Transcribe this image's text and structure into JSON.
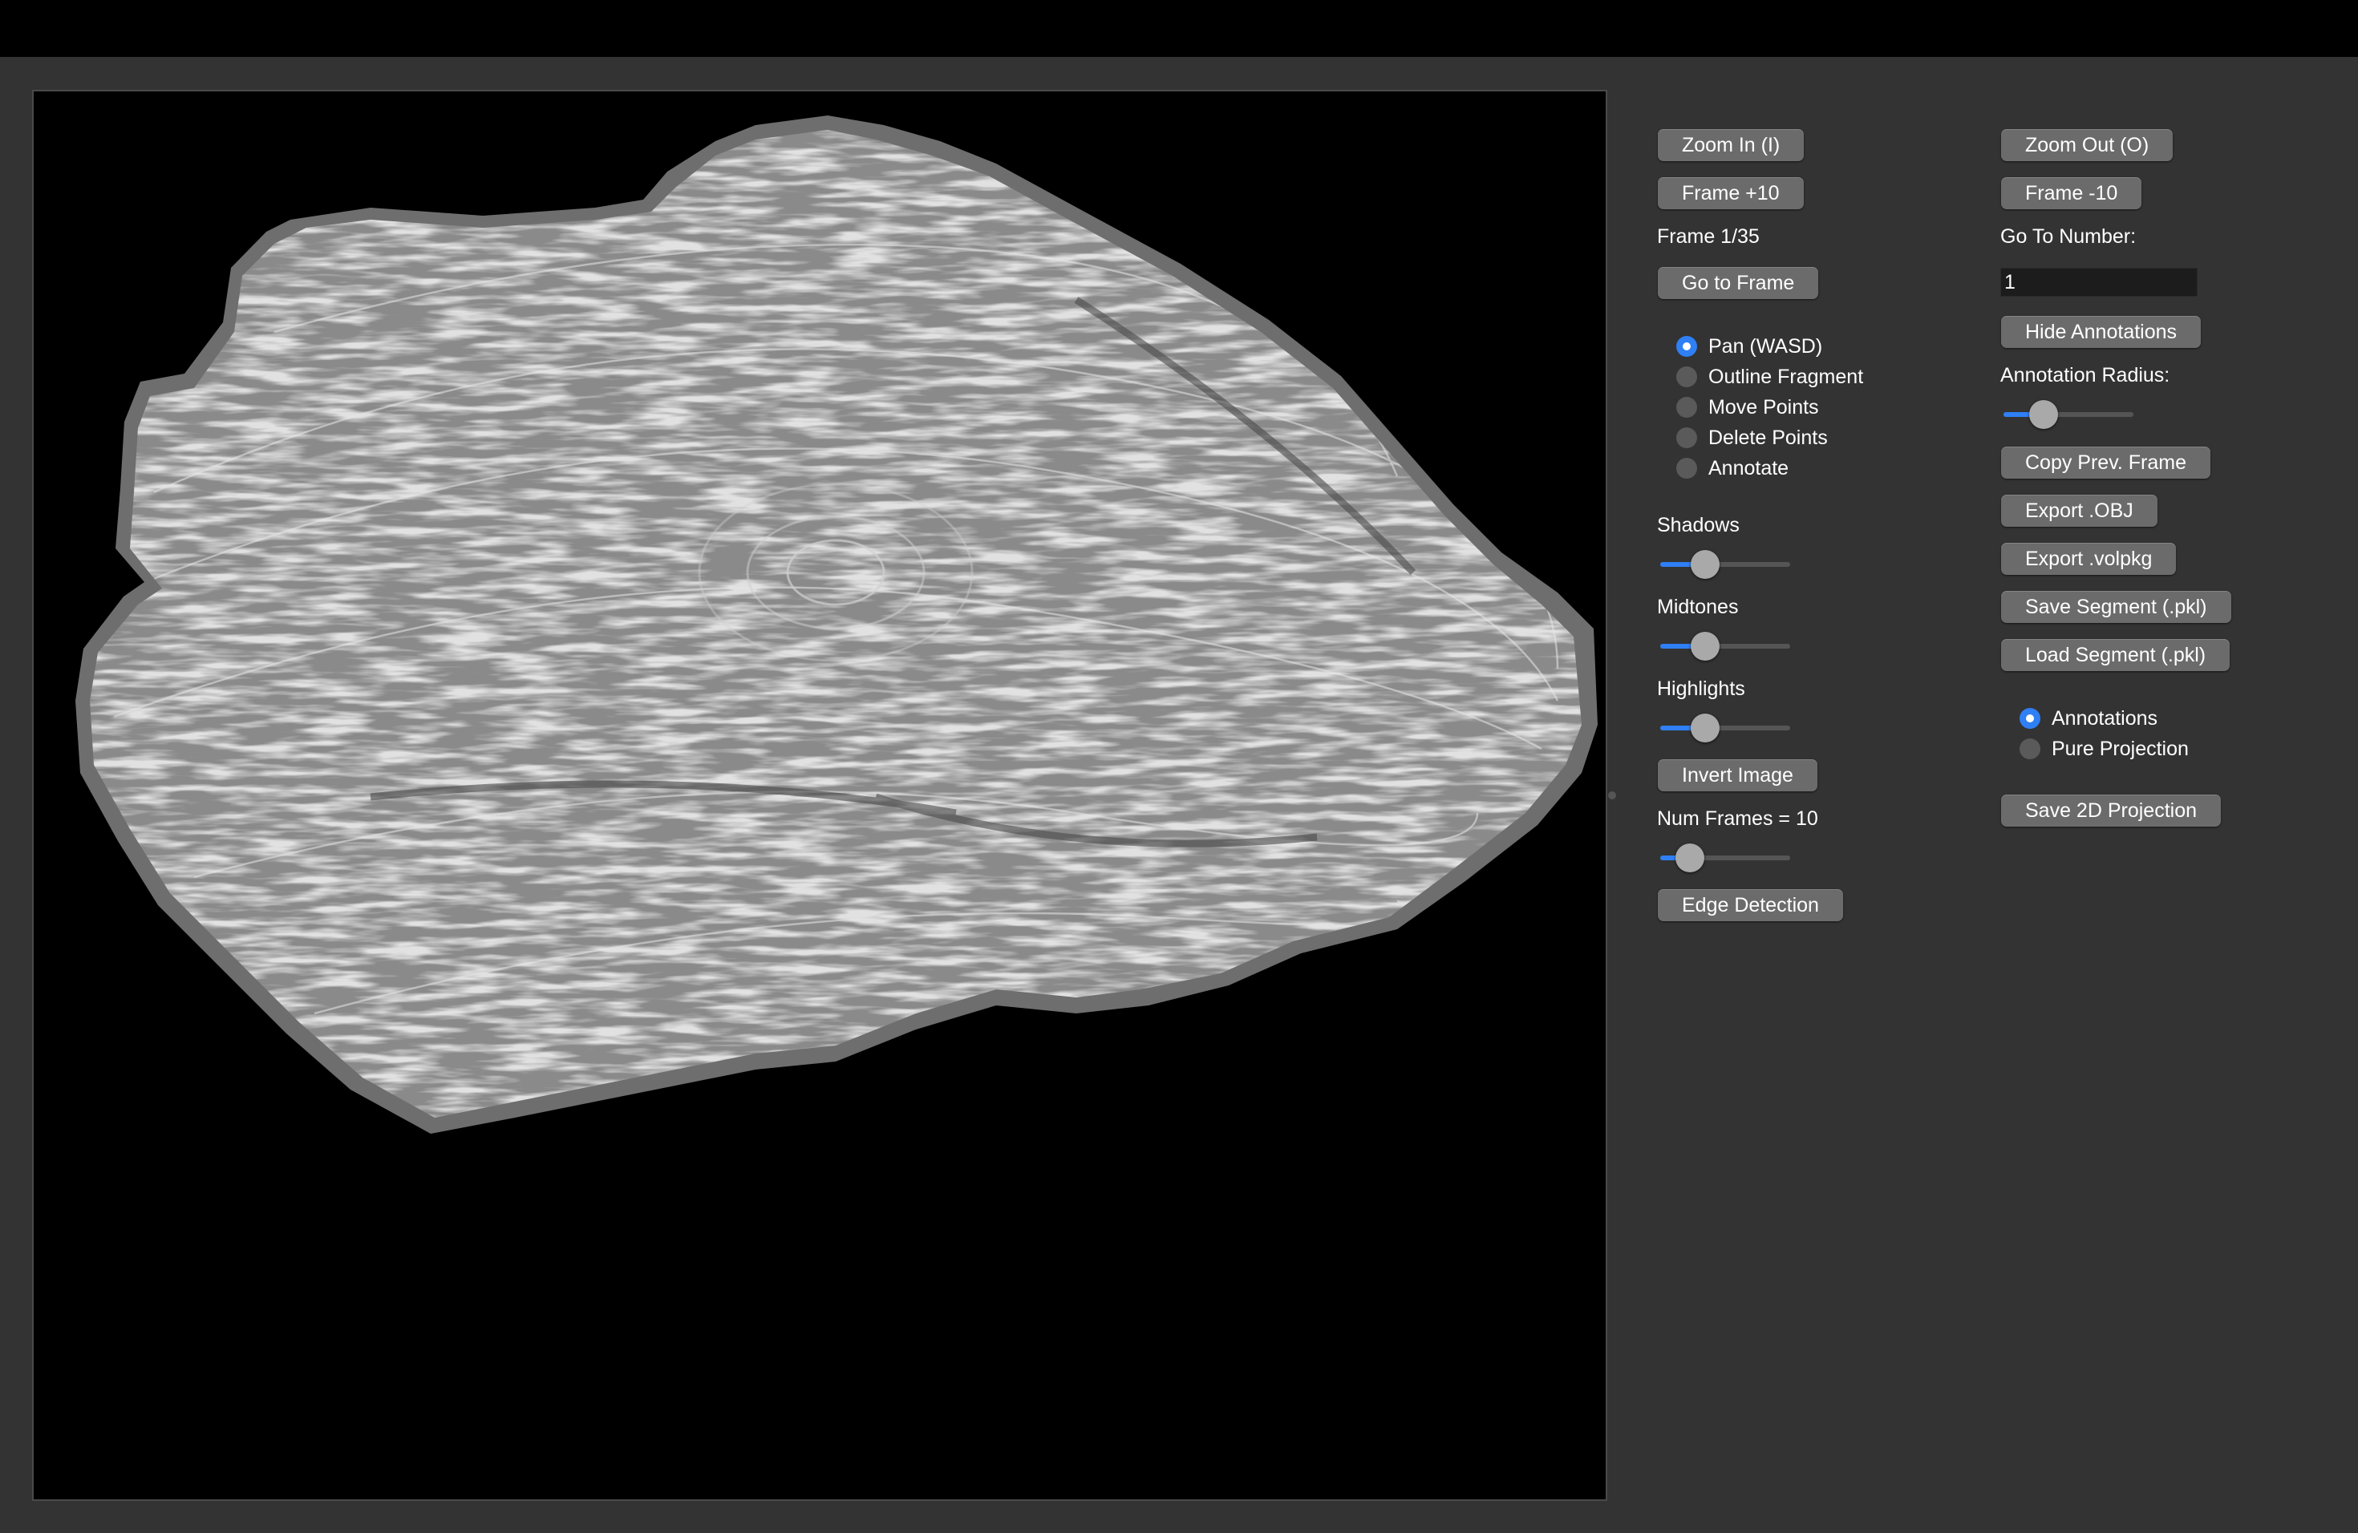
{
  "colors": {
    "window_bg": "#333333",
    "titlebar": "#000000",
    "canvas_bg": "#000000",
    "button_bg": "#6b6b6b",
    "accent": "#2f7ff5",
    "fragment": "#b4b4b4"
  },
  "viewer": {
    "image": "scroll-ct-slice",
    "icon": "ct-scan-slice"
  },
  "left_controls": {
    "zoom_in": "Zoom In (I)",
    "frame_plus": "Frame +10",
    "frame_status": "Frame 1/35",
    "go_to_frame": "Go to Frame",
    "modes": [
      {
        "label": "Pan (WASD)",
        "selected": true
      },
      {
        "label": "Outline Fragment",
        "selected": false
      },
      {
        "label": "Move Points",
        "selected": false
      },
      {
        "label": "Delete Points",
        "selected": false
      },
      {
        "label": "Annotate",
        "selected": false
      }
    ],
    "shadows_label": "Shadows",
    "shadows_value": 0.3,
    "midtones_label": "Midtones",
    "midtones_value": 0.3,
    "highlights_label": "Highlights",
    "highlights_value": 0.3,
    "invert_image": "Invert Image",
    "num_frames_label": "Num Frames = 10",
    "num_frames_value": 0.15,
    "edge_detection": "Edge Detection"
  },
  "right_controls": {
    "zoom_out": "Zoom Out (O)",
    "frame_minus": "Frame -10",
    "goto_label": "Go To Number:",
    "goto_value": "1",
    "hide_annotations": "Hide Annotations",
    "annotation_radius_label": "Annotation Radius:",
    "annotation_radius_value": 0.25,
    "copy_prev_frame": "Copy Prev. Frame",
    "export_obj": "Export .OBJ",
    "export_volpkg": "Export .volpkg",
    "save_segment": "Save Segment (.pkl)",
    "load_segment": "Load Segment (.pkl)",
    "view_modes": [
      {
        "label": "Annotations",
        "selected": true
      },
      {
        "label": "Pure Projection",
        "selected": false
      }
    ],
    "save_projection": "Save 2D Projection"
  }
}
